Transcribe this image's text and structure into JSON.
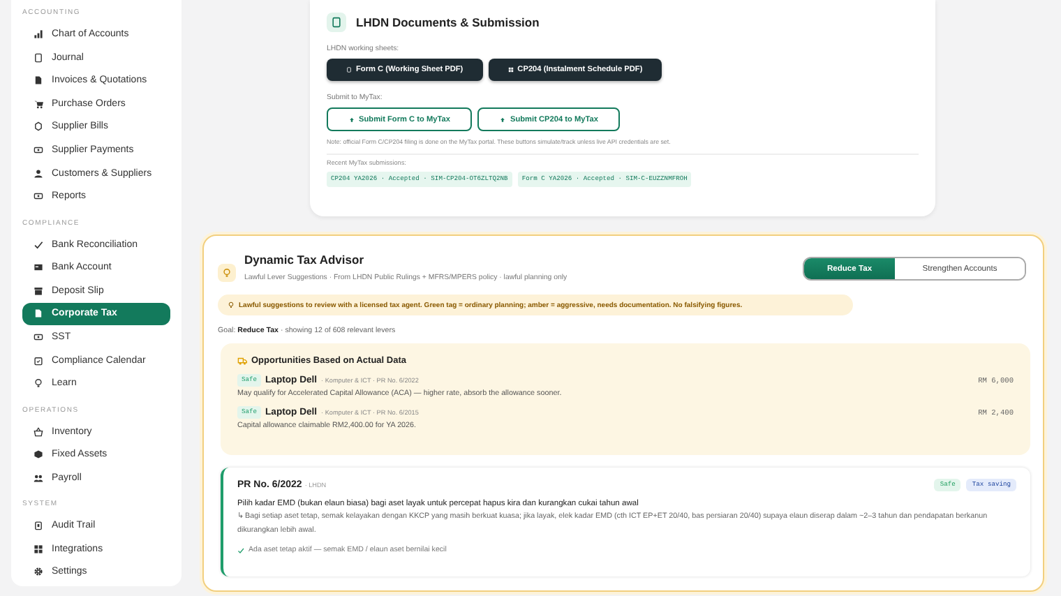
{
  "sidebar": {
    "sections": [
      {
        "heading": "ACCOUNTING",
        "items": [
          {
            "label": "Chart of Accounts",
            "selected": false
          },
          {
            "label": "Journal",
            "selected": false
          },
          {
            "label": "Invoices & Quotations",
            "selected": false
          },
          {
            "label": "Purchase Orders",
            "selected": false
          },
          {
            "label": "Supplier Bills",
            "selected": false
          },
          {
            "label": "Supplier Payments",
            "selected": false
          },
          {
            "label": "Customers & Suppliers",
            "selected": false
          },
          {
            "label": "Reports",
            "selected": false
          }
        ]
      },
      {
        "heading": "COMPLIANCE",
        "items": [
          {
            "label": "Bank Reconciliation",
            "selected": false
          },
          {
            "label": "Bank Account",
            "selected": false
          },
          {
            "label": "Deposit Slip",
            "selected": false
          },
          {
            "label": "Corporate Tax",
            "selected": true
          },
          {
            "label": "SST",
            "selected": false
          },
          {
            "label": "Compliance Calendar",
            "selected": false
          },
          {
            "label": "Learn",
            "selected": false
          }
        ]
      },
      {
        "heading": "OPERATIONS",
        "items": [
          {
            "label": "Inventory",
            "selected": false
          },
          {
            "label": "Fixed Assets",
            "selected": false
          },
          {
            "label": "Payroll",
            "selected": false
          }
        ]
      },
      {
        "heading": "SYSTEM",
        "items": [
          {
            "label": "Audit Trail",
            "selected": false
          },
          {
            "label": "Integrations",
            "selected": false
          },
          {
            "label": "Settings",
            "selected": false
          }
        ]
      }
    ]
  },
  "documents": {
    "title": "LHDN Documents & Submission",
    "sheets_label": "LHDN working sheets:",
    "sheet_buttons": [
      "Form C (Working Sheet PDF)",
      "CP204 (Instalment Schedule PDF)"
    ],
    "submit_label": "Submit to MyTax:",
    "submit_buttons": [
      "Submit Form C to MyTax",
      "Submit CP204 to MyTax"
    ],
    "note": "Note: official Form C/CP204 filing is done on the MyTax portal. These buttons simulate/track unless live API credentials are set.",
    "recent_label": "Recent MyTax submissions:",
    "submissions": [
      "CP204 YA2026 · Accepted · SIM-CP204-OT6ZLTQ2NB",
      "Form C YA2026 · Accepted · SIM-C-EUZZNMFROH"
    ]
  },
  "advisor": {
    "title": "Dynamic Tax Advisor",
    "subtitle": "Lawful Lever Suggestions · From LHDN Public Rulings + MFRS/MPERS policy · lawful planning only",
    "modes": [
      {
        "label": "Reduce Tax",
        "selected": true
      },
      {
        "label": "Strengthen Accounts",
        "selected": false
      }
    ],
    "banner": "Lawful suggestions to review with a licensed tax agent. Green tag = ordinary planning; amber = aggressive, needs documentation. No falsifying figures.",
    "goal": "Goal: **Reduce Tax** · showing 12 of 608 relevant levers",
    "opportunities": {
      "title": "Opportunities Based on Actual Data",
      "items": [
        {
          "tag": "Safe",
          "name": "Laptop Dell",
          "meta": "· Komputer & ICT · PR No. 6/2022",
          "amount": "RM 6,000",
          "description": "May qualify for Accelerated Capital Allowance (ACA) — higher rate, absorb the allowance sooner."
        },
        {
          "tag": "Safe",
          "name": "Laptop Dell",
          "meta": "· Komputer & ICT · PR No. 6/2015",
          "amount": "RM 2,400",
          "description": "Capital allowance claimable RM2,400.00 for YA 2026."
        }
      ]
    },
    "levers": [
      {
        "title": "PR No. 6/2022",
        "source": "· LHDN",
        "tags": [
          {
            "label": "Safe",
            "color": "#e3f5ec"
          },
          {
            "label": "Tax saving",
            "color": "#e4ebfb"
          }
        ],
        "headline": "Pilih kadar EMD (bukan elaun biasa) bagi aset layak untuk percepat hapus kira dan kurangkan cukai tahun awal",
        "detail": "↳ Bagi setiap aset tetap, semak kelayakan dengan KKCP yang masih berkuat kuasa; jika layak, elek kadar EMD (cth ICT EP+ET 20/40, bas persiaran 20/40) supaya elaun diserap dalam ~2–3 tahun dan pendapatan berkanun dikurangkan lebih awal.",
        "check": "Ada aset tetap aktif — semak EMD / elaun aset bernilai kecil"
      }
    ]
  }
}
